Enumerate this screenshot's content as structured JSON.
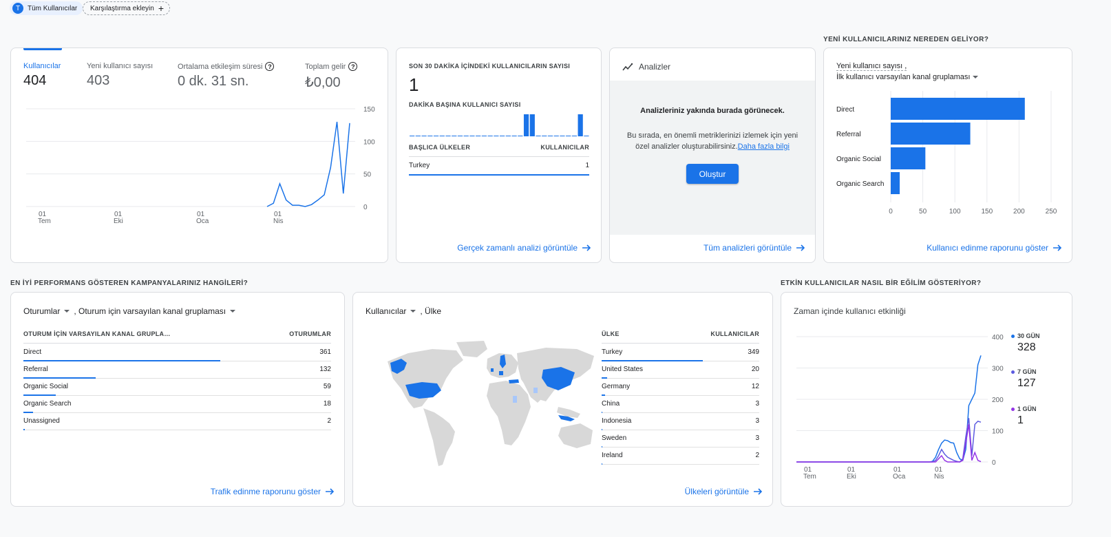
{
  "header": {
    "segment_avatar": "T",
    "segment_label": "Tüm Kullanıcılar",
    "compare_label": "Karşılaştırma ekleyin"
  },
  "colors": {
    "accent": "#1a73e8",
    "bar": "#1a73e8",
    "purple": "#9334e6",
    "indigo": "#5c5be0",
    "map_land": "#d8d8d8",
    "map_high": "#1a73e8"
  },
  "overview": {
    "metrics": [
      {
        "label": "Kullanıcılar",
        "value": "404"
      },
      {
        "label": "Yeni kullanıcı sayısı",
        "value": "403"
      },
      {
        "label": "Ortalama etkileşim süresi",
        "value": "0 dk. 31 sn."
      },
      {
        "label": "Toplam gelir",
        "value": "₺0,00"
      }
    ],
    "y_ticks": [
      "150",
      "100",
      "50",
      "0"
    ],
    "x_ticks": [
      {
        "day": "01",
        "month": "Tem"
      },
      {
        "day": "01",
        "month": "Eki"
      },
      {
        "day": "01",
        "month": "Oca"
      },
      {
        "day": "01",
        "month": "Nis"
      }
    ]
  },
  "realtime": {
    "title": "SON 30 DAKİKA İÇİNDEKİ KULLANICILARIN SAYISI",
    "value": "1",
    "per_minute_label": "DAKİKA BAŞINA KULLANICI SAYISI",
    "col_country": "BAŞLICA ÜLKELER",
    "col_users": "KULLANICILAR",
    "rows": [
      {
        "name": "Turkey",
        "value": "1"
      }
    ],
    "link": "Gerçek zamanlı analizi görüntüle"
  },
  "insights": {
    "title": "Analizler",
    "heading": "Analizleriniz yakında burada görünecek.",
    "body": "Bu sırada, en önemli metriklerinizi izlemek için yeni özel analizler oluşturabilirsiniz.",
    "learn_more": "Daha fazla bilgi",
    "button": "Oluştur",
    "link": "Tüm analizleri görüntüle"
  },
  "acquisition": {
    "section_title": "YENİ KULLANICILARINIZ NEREDEN GELİYOR?",
    "metric_label": "Yeni kullanıcı sayısı ,",
    "dimension_label": "İlk kullanıcı varsayılan kanal gruplaması",
    "link": "Kullanıcı edinme raporunu göster"
  },
  "campaigns": {
    "section_title": "EN İYİ PERFORMANS GÖSTEREN KAMPANYALARINIZ HANGİLERİ?",
    "metric_label": "Oturumlar",
    "dimension_label": ", Oturum için varsayılan kanal gruplaması",
    "col_name": "OTURUM İÇİN VARSAYILAN KANAL GRUPLA…",
    "col_value": "OTURUMLAR",
    "rows": [
      {
        "name": "Direct",
        "value": "361",
        "share": 1.0
      },
      {
        "name": "Referral",
        "value": "132",
        "share": 0.366
      },
      {
        "name": "Organic Social",
        "value": "59",
        "share": 0.163
      },
      {
        "name": "Organic Search",
        "value": "18",
        "share": 0.05
      },
      {
        "name": "Unassigned",
        "value": "2",
        "share": 0.006
      }
    ],
    "link": "Trafik edinme raporunu göster"
  },
  "countries": {
    "metric_label": "Kullanıcılar",
    "dimension_label": ", Ülke",
    "col_name": "ÜLKE",
    "col_value": "KULLANICILAR",
    "rows": [
      {
        "name": "Turkey",
        "value": "349",
        "share": 1.0
      },
      {
        "name": "United States",
        "value": "20",
        "share": 0.057
      },
      {
        "name": "Germany",
        "value": "12",
        "share": 0.034
      },
      {
        "name": "China",
        "value": "3",
        "share": 0.009
      },
      {
        "name": "Indonesia",
        "value": "3",
        "share": 0.009
      },
      {
        "name": "Sweden",
        "value": "3",
        "share": 0.009
      },
      {
        "name": "Ireland",
        "value": "2",
        "share": 0.006
      }
    ],
    "link": "Ülkeleri görüntüle"
  },
  "activity": {
    "section_title": "ETKİN KULLANICILAR NASIL BİR EĞİLİM GÖSTERİYOR?",
    "title": "Zaman içinde kullanıcı etkinliği",
    "y_ticks": [
      "400",
      "300",
      "200",
      "100",
      "0"
    ],
    "x_ticks": [
      {
        "day": "01",
        "month": "Tem"
      },
      {
        "day": "01",
        "month": "Eki"
      },
      {
        "day": "01",
        "month": "Oca"
      },
      {
        "day": "01",
        "month": "Nis"
      }
    ],
    "legend": [
      {
        "label": "30 GÜN",
        "value": "328"
      },
      {
        "label": "7 GÜN",
        "value": "127"
      },
      {
        "label": "1 GÜN",
        "value": "1"
      }
    ]
  },
  "chart_data": [
    {
      "type": "line",
      "series": [
        {
          "values": [
            0,
            5,
            35,
            10,
            2,
            2,
            0,
            3,
            10,
            18,
            60,
            130,
            20,
            128
          ]
        }
      ],
      "ylim": [
        0,
        150
      ]
    },
    {
      "type": "bar",
      "ylim": [
        0,
        1
      ],
      "values": [
        0,
        0,
        0,
        0,
        0,
        0,
        0,
        0,
        0,
        0,
        0,
        0,
        0,
        0,
        0,
        0,
        0,
        0,
        0,
        1,
        1,
        0,
        0,
        0,
        0,
        0,
        0,
        0,
        1,
        0
      ]
    },
    {
      "type": "bar",
      "categories": [
        "Direct",
        "Referral",
        "Organic Social",
        "Organic Search"
      ],
      "values": [
        209,
        124,
        54,
        14
      ],
      "xlim": [
        0,
        250
      ],
      "x_ticks": [
        "0",
        "50",
        "100",
        "150",
        "200",
        "250"
      ]
    },
    {
      "type": "line",
      "series": [
        {
          "name": "30 GÜN",
          "values": [
            0,
            0,
            0,
            0,
            0,
            0,
            0,
            0,
            0,
            0,
            0,
            0,
            0,
            0,
            0,
            0,
            0,
            0,
            0,
            0,
            0,
            0,
            0,
            0,
            0,
            0,
            0,
            0,
            0,
            0,
            0,
            0,
            0,
            0,
            0,
            0,
            0,
            0,
            0,
            0,
            0,
            0,
            0,
            0,
            0,
            2,
            15,
            40,
            60,
            70,
            68,
            62,
            60,
            30,
            10,
            5,
            40,
            180,
            200,
            220,
            310,
            340
          ]
        },
        {
          "name": "7 GÜN",
          "values": [
            0,
            0,
            0,
            0,
            0,
            0,
            0,
            0,
            0,
            0,
            0,
            0,
            0,
            0,
            0,
            0,
            0,
            0,
            0,
            0,
            0,
            0,
            0,
            0,
            0,
            0,
            0,
            0,
            0,
            0,
            0,
            0,
            0,
            0,
            0,
            0,
            0,
            0,
            0,
            0,
            0,
            0,
            0,
            0,
            0,
            0,
            5,
            20,
            40,
            25,
            15,
            10,
            5,
            2,
            0,
            10,
            80,
            140,
            20,
            120,
            130,
            127
          ]
        },
        {
          "name": "1 GÜN",
          "values": [
            0,
            0,
            0,
            0,
            0,
            0,
            0,
            0,
            0,
            0,
            0,
            0,
            0,
            0,
            0,
            0,
            0,
            0,
            0,
            0,
            0,
            0,
            0,
            0,
            0,
            0,
            0,
            0,
            0,
            0,
            0,
            0,
            0,
            0,
            0,
            0,
            0,
            0,
            0,
            0,
            0,
            0,
            0,
            0,
            0,
            0,
            0,
            10,
            20,
            5,
            0,
            0,
            0,
            0,
            0,
            5,
            60,
            120,
            5,
            30,
            5,
            1
          ]
        }
      ],
      "ylim": [
        0,
        400
      ]
    }
  ]
}
